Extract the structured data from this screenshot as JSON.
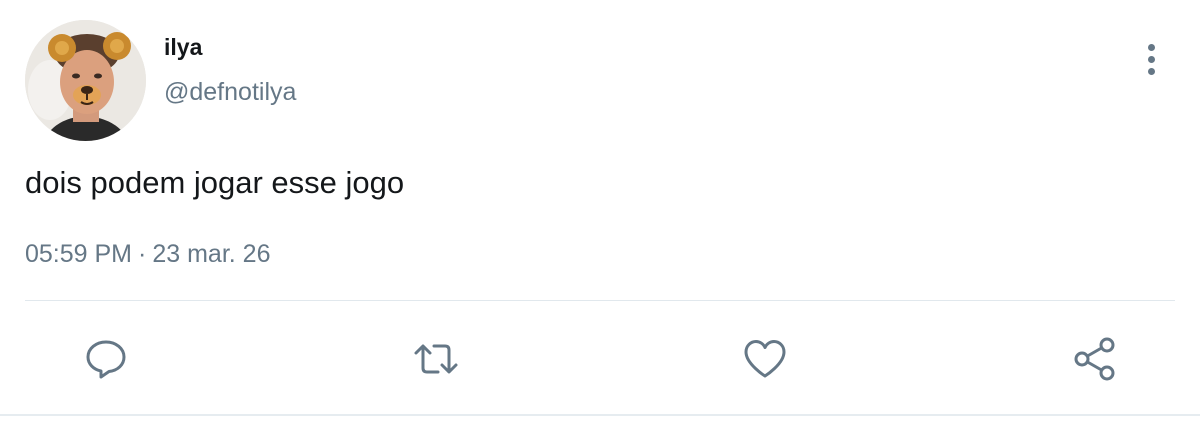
{
  "author": {
    "display_name": "ilya",
    "handle": "@defnotilya"
  },
  "tweet": {
    "text": "dois podem jogar esse jogo",
    "time": "05:59 PM",
    "separator": "·",
    "date": "23 mar. 26"
  },
  "actions": {
    "reply_icon": "reply-icon",
    "retweet_icon": "retweet-icon",
    "like_icon": "heart-icon",
    "share_icon": "share-icon"
  },
  "colors": {
    "primary_text": "#14171a",
    "secondary_text": "#657786",
    "divider": "#e1e8ed",
    "background": "#ffffff"
  }
}
